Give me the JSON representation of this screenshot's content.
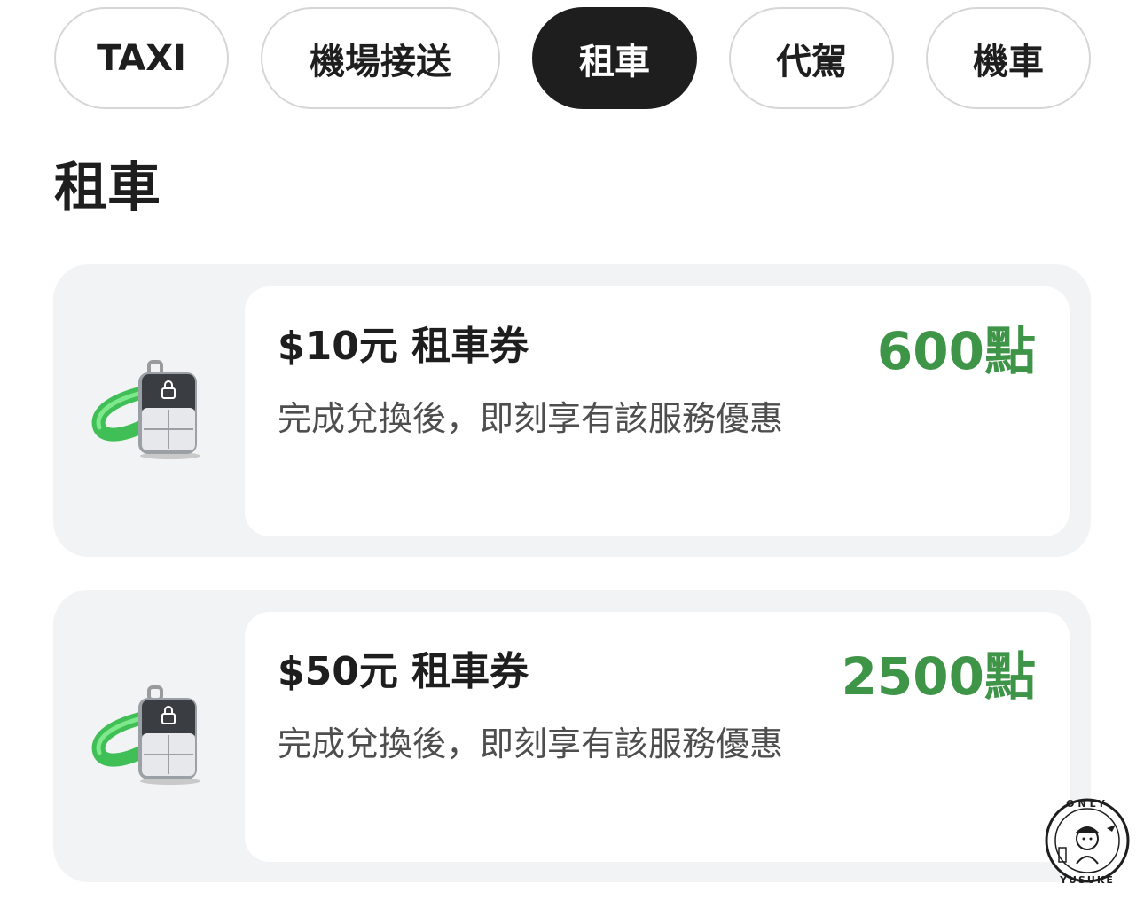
{
  "categories": {
    "items": [
      {
        "label": "TAXI"
      },
      {
        "label": "機場接送"
      },
      {
        "label": "租車"
      },
      {
        "label": "代駕"
      },
      {
        "label": "機車"
      }
    ],
    "selected": "租車"
  },
  "section": {
    "title": "租車"
  },
  "coupons": [
    {
      "title": "$10元 租車券",
      "description": "完成兌換後，即刻享有該服務優惠",
      "points": "600點",
      "icon": "car-key-fob-icon"
    },
    {
      "title": "$50元 租車券",
      "description": "完成兌換後，即刻享有該服務優惠",
      "points": "2500點",
      "icon": "car-key-fob-icon"
    }
  ],
  "watermark": {
    "text_top": "ONLY",
    "text_bottom": "YUSUKE"
  },
  "colors": {
    "points_green": "#3e9447",
    "chip_active_bg": "#1e1e1e",
    "card_bg": "#f2f3f5",
    "keyfob_strap": "#4cd964"
  }
}
